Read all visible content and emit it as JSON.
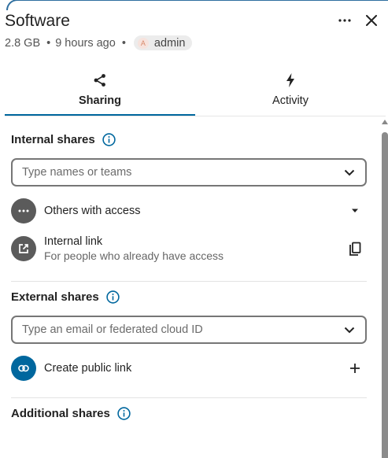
{
  "header": {
    "title": "Software",
    "size": "2.8 GB",
    "modified": "9 hours ago",
    "owner": "admin",
    "owner_initial": "A"
  },
  "tabs": [
    {
      "label": "Sharing",
      "icon": "share-icon",
      "active": true
    },
    {
      "label": "Activity",
      "icon": "lightning-icon",
      "active": false
    }
  ],
  "internal": {
    "title": "Internal shares",
    "search_placeholder": "Type names or teams",
    "others_access_label": "Others with access",
    "internal_link_label": "Internal link",
    "internal_link_sub": "For people who already have access"
  },
  "external": {
    "title": "External shares",
    "search_placeholder": "Type an email or federated cloud ID",
    "public_link_label": "Create public link"
  },
  "additional": {
    "title": "Additional shares"
  },
  "colors": {
    "accent": "#00679e",
    "icon_grey": "#5b5b5b",
    "avatar_bg": "#f7e3dd"
  }
}
